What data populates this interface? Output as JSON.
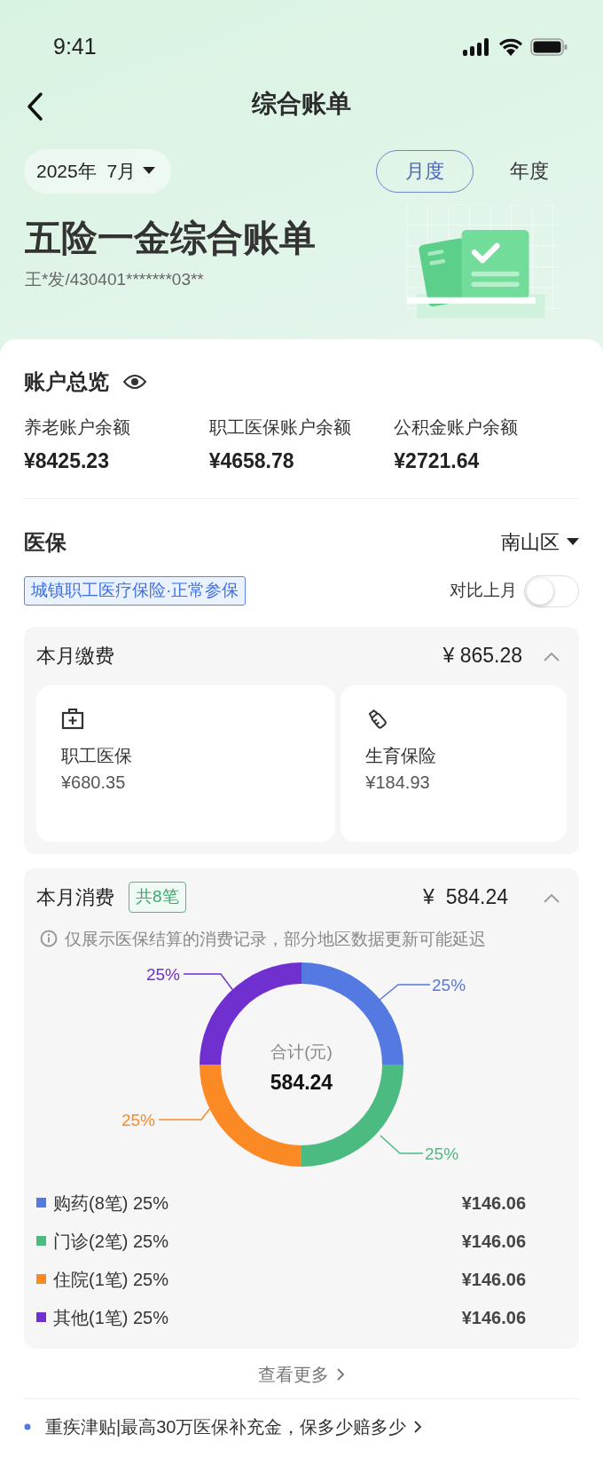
{
  "status_bar": {
    "time": "9:41"
  },
  "header": {
    "title": "综合账单"
  },
  "period": {
    "date": "2025年  7月",
    "tabs": [
      {
        "label": "月度",
        "selected": true
      },
      {
        "label": "年度",
        "selected": false
      }
    ]
  },
  "hero": {
    "title": "五险一金综合账单",
    "subtitle": "王*发/430401*******03**"
  },
  "overview": {
    "title": "账户总览",
    "accounts": [
      {
        "label": "养老账户余额",
        "amount": "¥8425.23"
      },
      {
        "label": "职工医保账户余额",
        "amount": "¥4658.78"
      },
      {
        "label": "公积金账户余额",
        "amount": "¥2721.64"
      }
    ]
  },
  "medical": {
    "title": "医保",
    "region": "南山区",
    "tag": "城镇职工医疗保险·正常参保",
    "compare": {
      "label": "对比上月",
      "on": false
    },
    "payment": {
      "title": "本月缴费",
      "amount": "¥ 865.28",
      "expanded": true,
      "items": [
        {
          "name": "职工医保",
          "amount": "¥680.35"
        },
        {
          "name": "生育保险",
          "amount": "¥184.93"
        }
      ]
    },
    "spending": {
      "title": "本月消费",
      "count": "共8笔",
      "amount": "¥  584.24",
      "expanded": true,
      "note": "仅展示医保结算的消费记录，部分地区数据更新可能延迟",
      "center_label": "合计(元)",
      "center_value": "584.24",
      "chart_data": {
        "type": "donut",
        "values": [
          25,
          25,
          25,
          25
        ],
        "value_labels": [
          "25%",
          "25%",
          "25%",
          "25%"
        ]
      },
      "legend": [
        {
          "label": "购药(8笔) 25%",
          "amount": "¥146.06",
          "color": "#5479e0"
        },
        {
          "label": "门诊(2笔) 25%",
          "amount": "¥146.06",
          "color": "#4cbb82"
        },
        {
          "label": "住院(1笔) 25%",
          "amount": "¥146.06",
          "color": "#fb8a25"
        },
        {
          "label": "其他(1笔) 25%",
          "amount": "¥146.06",
          "color": "#7030d0"
        }
      ]
    }
  },
  "more_link": "查看更多",
  "promo": "重疾津贴|最高30万医保补充金，保多少赔多少"
}
